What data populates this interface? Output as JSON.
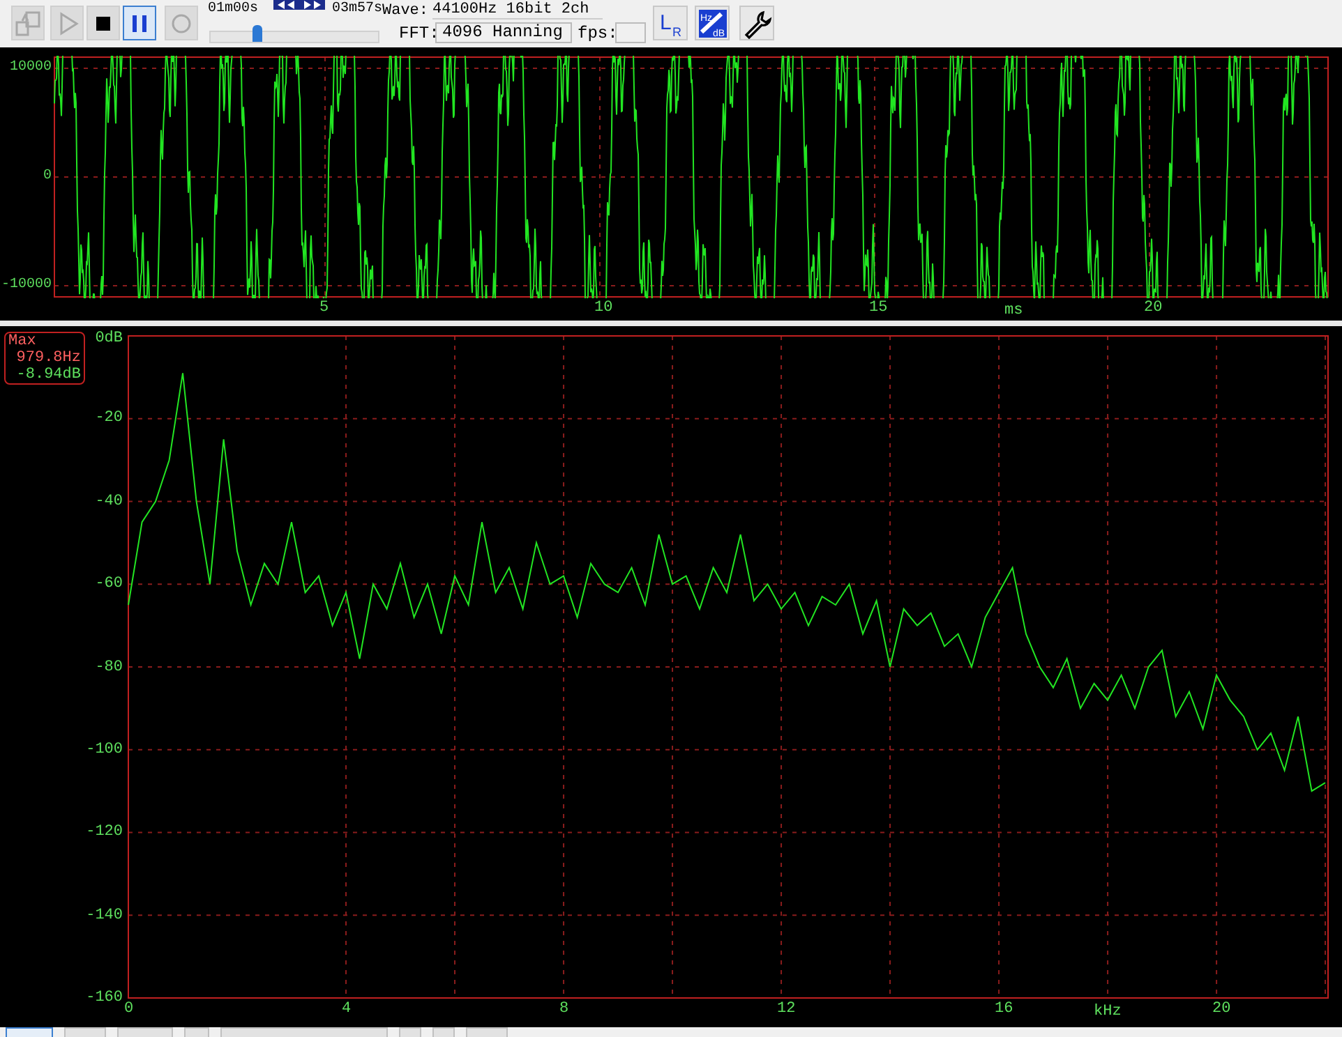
{
  "toolbar": {
    "buttons": [
      {
        "kind": "open",
        "disabled": true,
        "selected": false
      },
      {
        "kind": "play",
        "disabled": true,
        "selected": false
      },
      {
        "kind": "stop",
        "disabled": false,
        "selected": false
      },
      {
        "kind": "pause",
        "disabled": false,
        "selected": true
      },
      {
        "kind": "record",
        "disabled": true,
        "selected": false
      }
    ],
    "position": {
      "elapsed": "01m00s",
      "total": "03m57s",
      "level": 0.27
    },
    "wave": {
      "label": "Wave:",
      "value": "44100Hz 16bit 2ch"
    },
    "fft": {
      "label": "FFT:",
      "value": "4096 Hanning"
    },
    "fps": {
      "label": "fps:"
    },
    "tools": [
      {
        "kind": "channels",
        "marks": [
          "L",
          "R"
        ]
      },
      {
        "kind": "scale",
        "marks": [
          "Hz",
          "dB"
        ]
      },
      {
        "kind": "settings"
      }
    ]
  },
  "waveform": {
    "yticks": [
      "10000",
      "0",
      "-10000"
    ],
    "xticks": [
      "5",
      "10",
      "15",
      "20"
    ],
    "x_unit": "ms"
  },
  "spectrum": {
    "max_box": {
      "label": "Max",
      "frequency": "979.8Hz",
      "level": "-8.94dB"
    },
    "chart_data": {
      "type": "line",
      "grid": true,
      "xlabel": "kHz",
      "xlim": [
        0,
        22.05
      ],
      "ylim": [
        -160,
        0
      ],
      "xticks": [
        0,
        4,
        8,
        12,
        16,
        20
      ],
      "yticks": [
        {
          "value": 0,
          "label": "0dB"
        },
        -20,
        -40,
        -60,
        -80,
        -100,
        -120,
        -140,
        -160
      ],
      "x": [
        0,
        0.25,
        0.5,
        0.75,
        1,
        1.25,
        1.5,
        1.75,
        2,
        2.25,
        2.5,
        2.75,
        3,
        3.25,
        3.5,
        3.75,
        4,
        4.25,
        4.5,
        4.75,
        5,
        5.25,
        5.5,
        5.75,
        6,
        6.25,
        6.5,
        6.75,
        7,
        7.25,
        7.5,
        7.75,
        8,
        8.25,
        8.5,
        8.75,
        9,
        9.25,
        9.5,
        9.75,
        10,
        10.25,
        10.5,
        10.75,
        11,
        11.25,
        11.5,
        11.75,
        12,
        12.25,
        12.5,
        12.75,
        13,
        13.25,
        13.5,
        13.75,
        14,
        14.25,
        14.5,
        14.75,
        15,
        15.25,
        15.5,
        15.75,
        16,
        16.25,
        16.5,
        16.75,
        17,
        17.25,
        17.5,
        17.75,
        18,
        18.25,
        18.5,
        18.75,
        19,
        19.25,
        19.5,
        19.75,
        20,
        20.25,
        20.5,
        20.75,
        21,
        21.25,
        21.5,
        21.75,
        22
      ],
      "series": [
        {
          "color": "#22e522",
          "values": [
            -65,
            -45,
            -40,
            -30,
            -9,
            -40,
            -60,
            -25,
            -52,
            -65,
            -55,
            -60,
            -45,
            -62,
            -58,
            -70,
            -62,
            -78,
            -60,
            -66,
            -55,
            -68,
            -60,
            -72,
            -58,
            -65,
            -45,
            -62,
            -56,
            -66,
            -50,
            -60,
            -58,
            -68,
            -55,
            -60,
            -62,
            -56,
            -65,
            -48,
            -60,
            -58,
            -66,
            -56,
            -62,
            -48,
            -64,
            -60,
            -66,
            -62,
            -70,
            -63,
            -65,
            -60,
            -72,
            -64,
            -80,
            -66,
            -70,
            -67,
            -75,
            -72,
            -80,
            -68,
            -62,
            -56,
            -72,
            -80,
            -85,
            -78,
            -90,
            -84,
            -88,
            -82,
            -90,
            -80,
            -76,
            -92,
            -86,
            -95,
            -82,
            -88,
            -92,
            -100,
            -96,
            -105,
            -92,
            -110,
            -108
          ]
        }
      ]
    }
  }
}
